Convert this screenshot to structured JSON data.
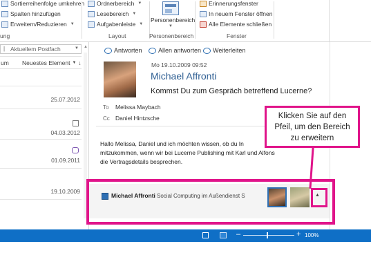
{
  "ribbon": {
    "sort_reverse": "Sortierreihenfolge umkehren",
    "add_columns": "Spalten hinzufügen",
    "expand_collapse": "Erweitern/Reduzieren",
    "group_view_label_partial": "ung",
    "folder_pane": "Ordnerbereich",
    "reading_pane": "Lesebereich",
    "todo_bar": "Aufgabenleiste",
    "layout_label": "Layout",
    "people_pane": "Personenbereich",
    "people_pane_group": "Personenbereich",
    "reminders_window": "Erinnerungsfenster",
    "open_new_window": "In neuem Fenster öffnen",
    "close_all_items": "Alle Elemente schließen",
    "window_label": "Fenster"
  },
  "list": {
    "search_placeholder": "Aktuellem Postfach",
    "col_from_partial": "um",
    "col_newest": "Neuestes Element",
    "dates": [
      "25.07.2012",
      "04.03.2012",
      "01.09.2011",
      "19.10.2009"
    ]
  },
  "reading": {
    "reply": "Antworten",
    "reply_all": "Allen antworten",
    "forward": "Weiterleiten",
    "date": "Mo 19.10.2009 09:52",
    "sender": "Michael Affronti",
    "subject": "Kommst Du zum Gespräch betreffend Lucerne?",
    "to_label": "To",
    "to_value": "Melissa Maybach",
    "cc_label": "Cc",
    "cc_value": "Daniel Hintzsche",
    "body_line1": "Hallo Melissa, Daniel und ich möchten wissen, ob du In",
    "body_line2": "mitzukommen, wenn wir bei Lucerne Publishing mit Karl und Alfons",
    "body_line3": "die Vertragsdetails besprechen."
  },
  "people_pane": {
    "name": "Michael Affronti",
    "status": "Social Computing im Außendienst S"
  },
  "callout": {
    "line1": "Klicken Sie auf den",
    "line2": "Pfeil, um den Bereich",
    "line3": "zu erweitern"
  },
  "statusbar": {
    "zoom": "100%"
  },
  "colors": {
    "accent": "#0f6fc6",
    "callout": "#e0148a",
    "sender_name": "#2f5f93"
  }
}
